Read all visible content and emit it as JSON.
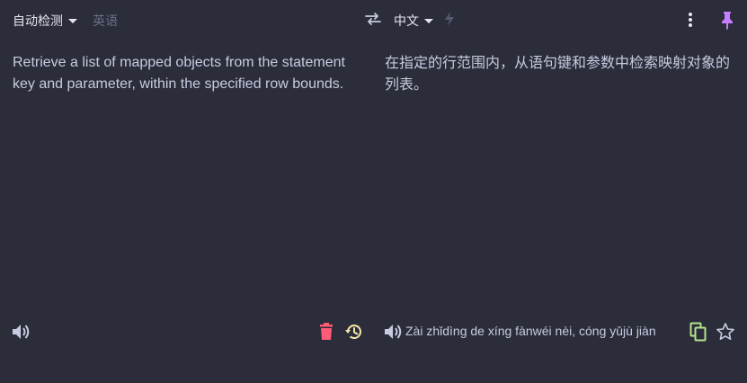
{
  "header": {
    "source_language": "自动检测",
    "detected_language": "英语",
    "target_language": "中文"
  },
  "source": {
    "text": "Retrieve a list of mapped objects from the statement key and parameter, within the specified row bounds."
  },
  "target": {
    "text": "在指定的行范围内，从语句键和参数中检索映射对象的列表。",
    "pinyin": "Zài zhǐdìng de xíng fànwéi nèi, cóng yǔjù jiàn"
  },
  "colors": {
    "background": "#2b2d3b",
    "text": "#c8cbe0",
    "delete": "#ff5c77",
    "history": "#f7e6a5",
    "copy": "#b5e48c",
    "pin": "#c77dff"
  },
  "icons": [
    "swap-icon",
    "lightning-icon",
    "more-vert-icon",
    "pin-icon",
    "speaker-icon",
    "trash-icon",
    "history-icon",
    "copy-icon",
    "star-icon"
  ]
}
